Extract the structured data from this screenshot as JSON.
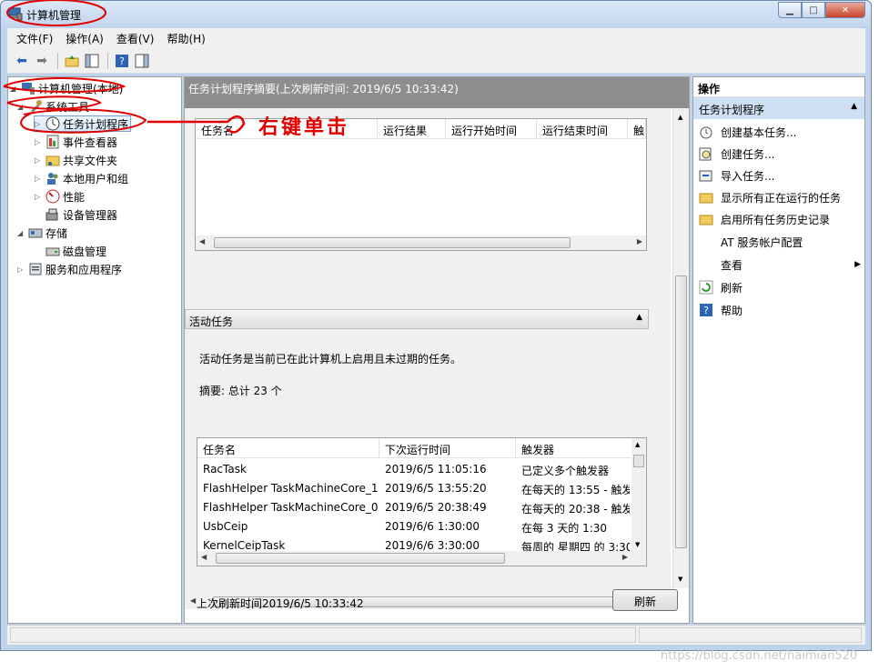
{
  "window": {
    "title": "计算机管理",
    "min": "▁",
    "max": "□",
    "close": "✕"
  },
  "menu": [
    "文件(F)",
    "操作(A)",
    "查看(V)",
    "帮助(H)"
  ],
  "tree": {
    "root": "计算机管理(本地)",
    "system_tools": "系统工具",
    "task_scheduler": "任务计划程序",
    "event_viewer": "事件查看器",
    "shared_folders": "共享文件夹",
    "local_users": "本地用户和组",
    "performance": "性能",
    "device_manager": "设备管理器",
    "storage": "存储",
    "disk_management": "磁盘管理",
    "services_apps": "服务和应用程序"
  },
  "center": {
    "summary_title": "任务计划程序摘要(上次刷新时间: 2019/6/5 10:33:42)",
    "grid1_columns": [
      "任务名",
      "运行结果",
      "运行开始时间",
      "运行结束时间",
      "触"
    ],
    "active_section": "活动任务",
    "active_desc": "活动任务是当前已在此计算机上启用且未过期的任务。",
    "summary_line": "摘要: 总计 23 个",
    "grid2_columns": [
      "任务名",
      "下次运行时间",
      "触发器"
    ],
    "grid2_rows": [
      [
        "RacTask",
        "2019/6/5 11:05:16",
        "已定义多个触发器"
      ],
      [
        "FlashHelper TaskMachineCore_1",
        "2019/6/5 13:55:20",
        "在每天的 13:55 - 触发"
      ],
      [
        "FlashHelper TaskMachineCore_0",
        "2019/6/5 20:38:49",
        "在每天的 20:38 - 触发"
      ],
      [
        "UsbCeip",
        "2019/6/6 1:30:00",
        "在每 3 天的 1:30"
      ],
      [
        "KernelCeipTask",
        "2019/6/6 3:30:00",
        "每周的 星期四 的 3:30"
      ]
    ],
    "last_refresh": "上次刷新时间2019/6/5 10:33:42",
    "refresh_button": "刷新"
  },
  "actions": {
    "header": "操作",
    "subheader": "任务计划程序",
    "items": [
      "创建基本任务...",
      "创建任务...",
      "导入任务...",
      "显示所有正在运行的任务",
      "启用所有任务历史记录",
      "AT 服务帐户配置",
      "查看",
      "刷新",
      "帮助"
    ]
  },
  "annotation": {
    "text": "右键单击"
  },
  "watermark": "https://blog.csdn.net/haimian520",
  "colors": {
    "annotation_red": "#e00000",
    "header_gray": "#8e8e8e",
    "selection_blue": "#cfdff2"
  }
}
